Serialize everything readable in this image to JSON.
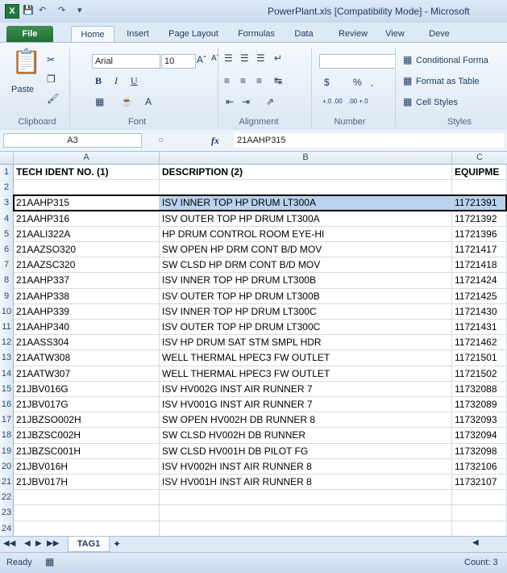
{
  "window": {
    "title": "PowerPlant.xls  [Compatibility Mode]  -  Microsoft"
  },
  "tabs": [
    "File",
    "Home",
    "Insert",
    "Page Layout",
    "Formulas",
    "Data",
    "Review",
    "View",
    "Deve"
  ],
  "ribbon": {
    "clipboard": {
      "paste": "Paste",
      "label": "Clipboard"
    },
    "font": {
      "name": "Arial",
      "size": "10",
      "label": "Font"
    },
    "alignment": {
      "label": "Alignment"
    },
    "number": {
      "format": "",
      "label": "Number",
      "currency": "$",
      "percent": "%",
      "comma": ",",
      "inc_decimal": "+.0 .00",
      "dec_decimal": ".00 +.0"
    },
    "styles": {
      "conditional": "Conditional Forma",
      "format_table": "Format as Table",
      "cell_styles": "Cell Styles",
      "label": "Styles"
    }
  },
  "formula_bar": {
    "name_box": "A3",
    "fx": "fx",
    "value": "21AAHP315"
  },
  "columns": [
    "A",
    "B",
    "C"
  ],
  "header_row": [
    "TECH IDENT NO. (1)",
    "DESCRIPTION (2)",
    "EQUIPME"
  ],
  "rows": [
    {
      "n": "1"
    },
    {
      "n": "2",
      "a": "",
      "b": "",
      "c": ""
    },
    {
      "n": "3",
      "a": "21AAHP315",
      "b": "ISV INNER TOP HP DRUM LT300A",
      "c": "11721391"
    },
    {
      "n": "4",
      "a": "21AAHP316",
      "b": "ISV OUTER TOP HP DRUM LT300A",
      "c": "11721392"
    },
    {
      "n": "5",
      "a": "21AALI322A",
      "b": "HP DRUM CONTROL ROOM EYE-HI",
      "c": "11721396"
    },
    {
      "n": "6",
      "a": "21AAZSO320",
      "b": "SW OPEN HP DRM CONT B/D MOV",
      "c": "11721417"
    },
    {
      "n": "7",
      "a": "21AAZSC320",
      "b": "SW CLSD HP DRM CONT B/D MOV",
      "c": "11721418"
    },
    {
      "n": "8",
      "a": "21AAHP337",
      "b": "ISV INNER TOP HP DRUM LT300B",
      "c": "11721424"
    },
    {
      "n": "9",
      "a": "21AAHP338",
      "b": "ISV OUTER TOP HP DRUM LT300B",
      "c": "11721425"
    },
    {
      "n": "10",
      "a": "21AAHP339",
      "b": "ISV INNER TOP HP DRUM LT300C",
      "c": "11721430"
    },
    {
      "n": "11",
      "a": "21AAHP340",
      "b": "ISV OUTER TOP HP DRUM LT300C",
      "c": "11721431"
    },
    {
      "n": "12",
      "a": "21AASS304",
      "b": "ISV HP DRUM SAT STM SMPL HDR",
      "c": "11721462"
    },
    {
      "n": "13",
      "a": "21AATW308",
      "b": "WELL THERMAL HPEC3 FW OUTLET",
      "c": "11721501"
    },
    {
      "n": "14",
      "a": "21AATW307",
      "b": "WELL THERMAL HPEC3 FW OUTLET",
      "c": "11721502"
    },
    {
      "n": "15",
      "a": "21JBV016G",
      "b": "ISV HV002G INST AIR RUNNER 7",
      "c": "11732088"
    },
    {
      "n": "16",
      "a": "21JBV017G",
      "b": "ISV HV001G INST AIR RUNNER 7",
      "c": "11732089"
    },
    {
      "n": "17",
      "a": "21JBZSO002H",
      "b": "SW OPEN HV002H DB RUNNER 8",
      "c": "11732093"
    },
    {
      "n": "18",
      "a": "21JBZSC002H",
      "b": "SW CLSD HV002H DB RUNNER",
      "c": "11732094"
    },
    {
      "n": "19",
      "a": "21JBZSC001H",
      "b": "SW CLSD HV001H DB PILOT FG",
      "c": "11732098"
    },
    {
      "n": "20",
      "a": "21JBV016H",
      "b": "ISV HV002H INST AIR RUNNER 8",
      "c": "11732106"
    },
    {
      "n": "21",
      "a": "21JBV017H",
      "b": "ISV HV001H INST AIR RUNNER 8",
      "c": "11732107"
    },
    {
      "n": "22",
      "a": "",
      "b": "",
      "c": ""
    },
    {
      "n": "23",
      "a": "",
      "b": "",
      "c": ""
    },
    {
      "n": "24",
      "a": "",
      "b": "",
      "c": ""
    }
  ],
  "sheet_tab": "TAG1",
  "status": {
    "ready": "Ready",
    "count": "Count: 3"
  },
  "colors": {
    "accent": "#1d7a3a",
    "selection": "#b9d3ee",
    "ribbon": "#dbe7f4"
  }
}
